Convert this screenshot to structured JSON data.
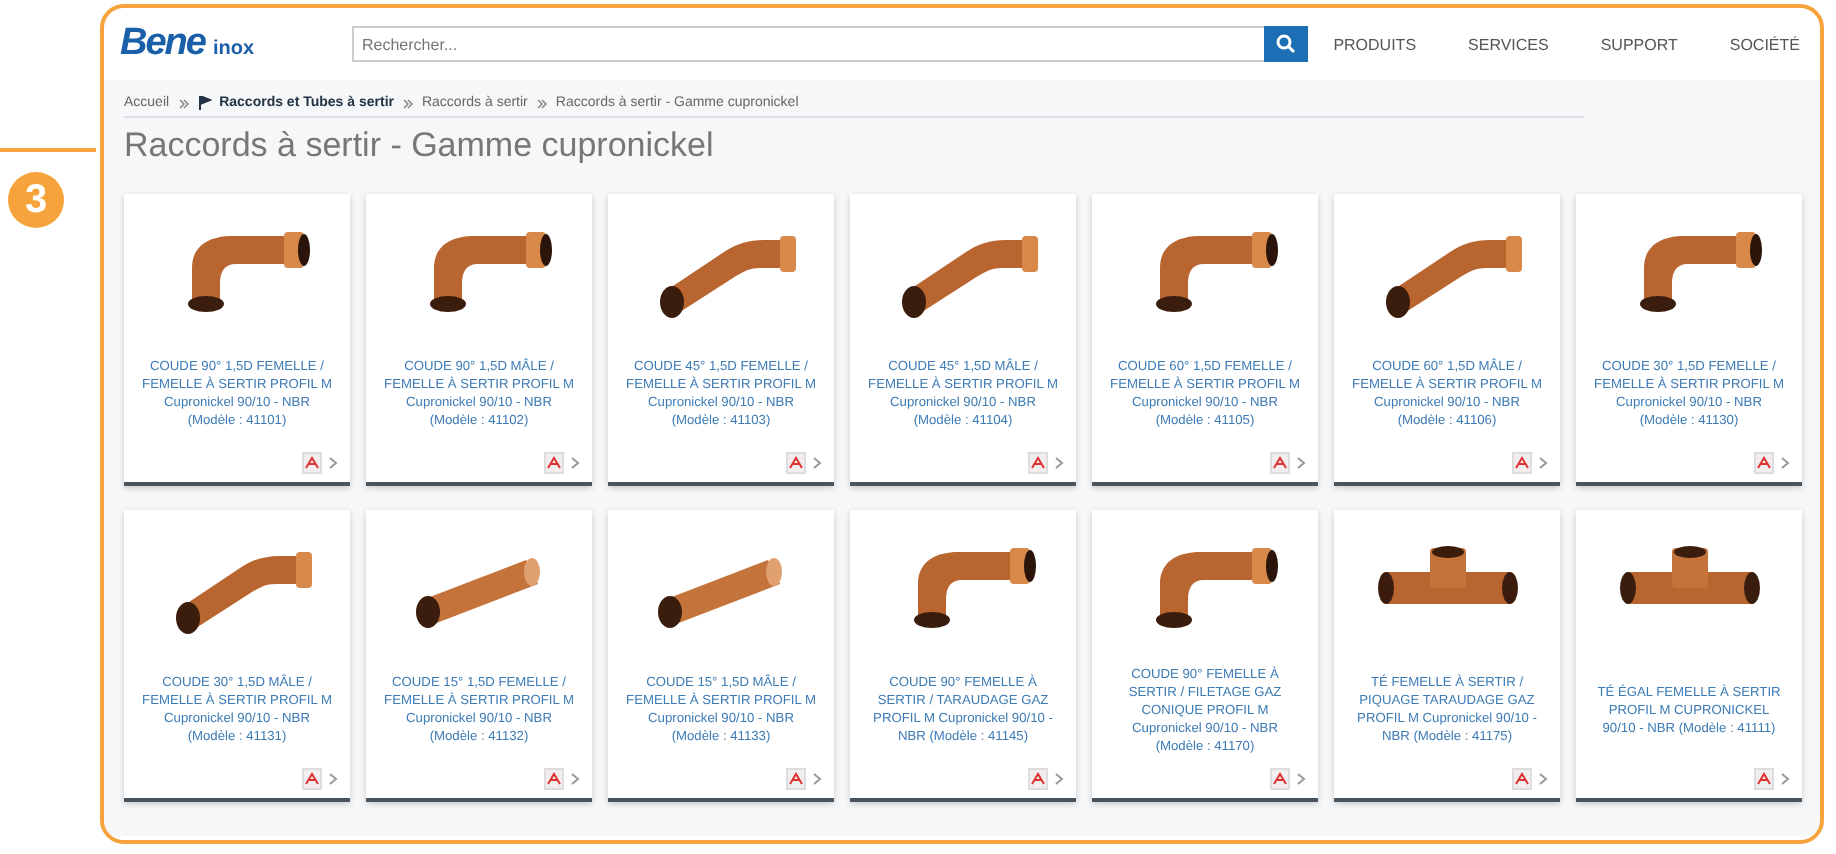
{
  "callout": {
    "number": "3"
  },
  "header": {
    "logo": {
      "brand": "Bene",
      "sub": "inox"
    },
    "search": {
      "placeholder": "Rechercher..."
    },
    "nav": [
      "PRODUITS",
      "SERVICES",
      "SUPPORT",
      "SOCIÉTÉ"
    ]
  },
  "breadcrumb": [
    {
      "label": "Accueil",
      "bold": false
    },
    {
      "label": "Raccords et Tubes à sertir",
      "bold": true
    },
    {
      "label": "Raccords à sertir",
      "bold": false
    },
    {
      "label": "Raccords à sertir - Gamme cupronickel",
      "bold": false
    }
  ],
  "page_title": "Raccords à sertir - Gamme cupronickel",
  "products": [
    {
      "kind": "elbow90",
      "name": "COUDE 90° 1,5D FEMELLE / FEMELLE À SERTIR PROFIL M Cupronickel 90/10 - NBR (Modèle : 41101)"
    },
    {
      "kind": "elbow90",
      "name": "COUDE 90° 1,5D MÂLE / FEMELLE À SERTIR PROFIL M Cupronickel 90/10 - NBR (Modèle : 41102)"
    },
    {
      "kind": "elbow45",
      "name": "COUDE 45° 1,5D FEMELLE / FEMELLE À SERTIR PROFIL M Cupronickel 90/10 - NBR (Modèle : 41103)"
    },
    {
      "kind": "elbow45",
      "name": "COUDE 45° 1,5D MÂLE / FEMELLE À SERTIR PROFIL M Cupronickel 90/10 - NBR (Modèle : 41104)"
    },
    {
      "kind": "elbow90",
      "name": "COUDE 60° 1,5D FEMELLE / FEMELLE À SERTIR PROFIL M Cupronickel 90/10 - NBR (Modèle : 41105)"
    },
    {
      "kind": "elbow45",
      "name": "COUDE 60° 1,5D MÂLE / FEMELLE À SERTIR PROFIL M Cupronickel 90/10 - NBR (Modèle : 41106)"
    },
    {
      "kind": "elbow90",
      "name": "COUDE 30° 1,5D FEMELLE / FEMELLE À SERTIR PROFIL M Cupronickel 90/10 - NBR (Modèle : 41130)"
    },
    {
      "kind": "elbow45",
      "name": "COUDE 30° 1,5D MÂLE / FEMELLE À SERTIR PROFIL M Cupronickel 90/10 - NBR (Modèle : 41131)"
    },
    {
      "kind": "straight",
      "name": "COUDE 15° 1,5D FEMELLE / FEMELLE À SERTIR PROFIL M Cupronickel 90/10 - NBR (Modèle : 41132)"
    },
    {
      "kind": "straight",
      "name": "COUDE 15° 1,5D MÂLE / FEMELLE À SERTIR PROFIL M Cupronickel 90/10 - NBR (Modèle : 41133)"
    },
    {
      "kind": "elbow90",
      "name": "COUDE 90° FEMELLE À SERTIR / TARAUDAGE GAZ PROFIL M Cupronickel 90/10 - NBR (Modèle : 41145)"
    },
    {
      "kind": "elbow90",
      "name": "COUDE 90° FEMELLE À SERTIR / FILETAGE GAZ CONIQUE PROFIL M Cupronickel 90/10 - NBR (Modèle : 41170)"
    },
    {
      "kind": "tee",
      "name": "TÉ FEMELLE À SERTIR / PIQUAGE TARAUDAGE GAZ PROFIL M Cupronickel 90/10 - NBR (Modèle : 41175)"
    },
    {
      "kind": "tee",
      "name": "TÉ ÉGAL FEMELLE À SERTIR PROFIL M CUPRONICKEL 90/10 - NBR (Modèle : 41111)"
    }
  ]
}
